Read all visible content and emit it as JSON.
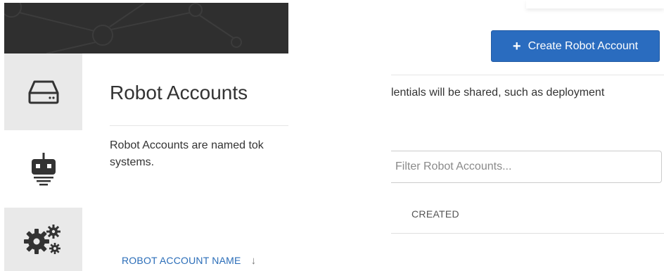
{
  "sidebar": {
    "tabs": [
      {
        "icon": "hdd-icon",
        "active": false
      },
      {
        "icon": "robot-icon",
        "active": true
      },
      {
        "icon": "gears-icon",
        "active": false
      }
    ]
  },
  "main": {
    "title": "Robot Accounts",
    "description_left_line1": "Robot Accounts are named tok",
    "description_left_line2": "systems.",
    "description_right": "lentials will be shared, such as deployment",
    "create_button_label": "Create Robot Account",
    "filter_placeholder": "Filter Robot Accounts...",
    "table": {
      "columns": [
        "ROBOT ACCOUNT NAME",
        "CREATED"
      ],
      "sort_indicator": "↓"
    }
  },
  "colors": {
    "primary": "#2a6cbf",
    "link": "#2a6db8",
    "banner": "#2f2f2f",
    "inactive_tab": "#e9e9e9"
  }
}
